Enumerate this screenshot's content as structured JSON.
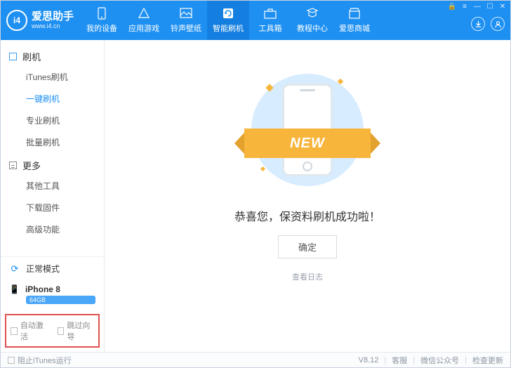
{
  "logo": {
    "mark": "i4",
    "title": "爱思助手",
    "sub": "www.i4.cn"
  },
  "top_tabs": [
    {
      "label": "我的设备"
    },
    {
      "label": "应用游戏"
    },
    {
      "label": "铃声壁纸"
    },
    {
      "label": "智能刷机"
    },
    {
      "label": "工具箱"
    },
    {
      "label": "教程中心"
    },
    {
      "label": "爱思商城"
    }
  ],
  "sidebar": {
    "group1": {
      "title": "刷机",
      "items": [
        "iTunes刷机",
        "一键刷机",
        "专业刷机",
        "批量刷机"
      ]
    },
    "group2": {
      "title": "更多",
      "items": [
        "其他工具",
        "下载固件",
        "高级功能"
      ]
    },
    "mode": "正常模式",
    "device": {
      "name": "iPhone 8",
      "badge": "64GB"
    },
    "checks": {
      "a": "自动激活",
      "b": "跳过向导"
    }
  },
  "main": {
    "ribbon": "NEW",
    "success": "恭喜您，保资料刷机成功啦！",
    "ok": "确定",
    "log": "查看日志"
  },
  "footer": {
    "block_itunes": "阻止iTunes运行",
    "version": "V8.12",
    "svc": "客服",
    "wx": "微信公众号",
    "upd": "检查更新"
  }
}
